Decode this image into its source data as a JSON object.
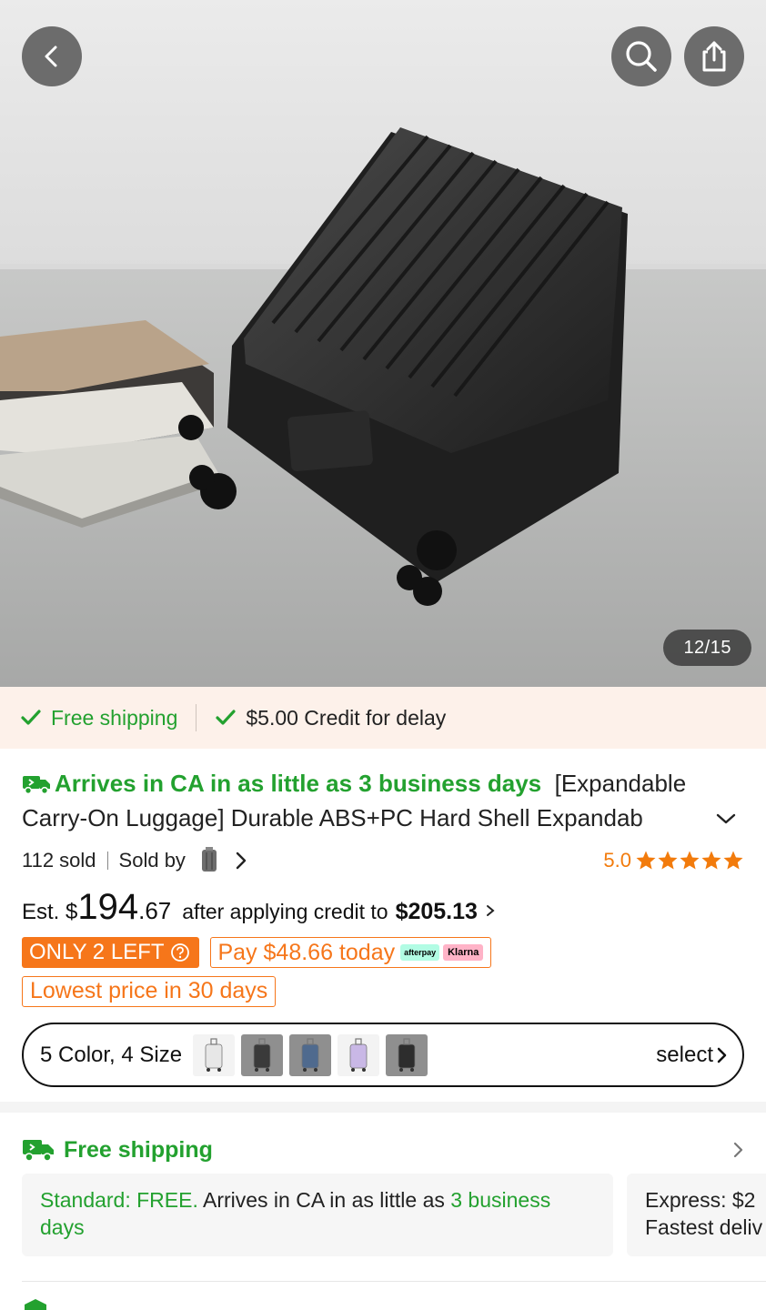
{
  "hero": {
    "counter": "12/15",
    "buttons": {
      "back": "back-icon",
      "search": "search-icon",
      "share": "share-icon"
    }
  },
  "strip": {
    "free_shipping": "Free shipping",
    "credit": "$5.00 Credit for delay"
  },
  "title": {
    "arrives": "Arrives in CA in as little as 3 business days",
    "text_line1": "[Expandable",
    "text_line2": "Carry-On Luggage] Durable ABS+PC Hard Shell Expandab"
  },
  "meta": {
    "sold": "112 sold",
    "sold_by": "Sold by",
    "rating": "5.0",
    "stars": 5
  },
  "price": {
    "est": "Est. $",
    "dollars": "194",
    "cents": ".67",
    "after": "after applying credit to",
    "credit_price": "$205.13"
  },
  "badges": {
    "only_left": "ONLY 2 LEFT",
    "pay_today": "Pay $48.66 today",
    "afterpay": "afterpay",
    "klarna": "Klarna",
    "lowest": "Lowest price in 30 days"
  },
  "variants": {
    "label": "5 Color, 4 Size",
    "select": "select",
    "thumb_colors": [
      "#e7e7e7",
      "#3a3a3a",
      "#4f6a8e",
      "#c9b8e6",
      "#2d2d2d"
    ]
  },
  "shipping": {
    "title": "Free shipping",
    "standard_prefix": "Standard: FREE.",
    "standard_mid": "Arrives in CA in as little as",
    "standard_days_a": "3 business",
    "standard_days_b": "days",
    "express_line1": "Express: $2",
    "express_line2": "Fastest deliv"
  },
  "colors": {
    "green": "#23a12f",
    "orange": "#f6761a",
    "rating_orange": "#f27b0c",
    "strip_bg": "#fdf1ea"
  }
}
